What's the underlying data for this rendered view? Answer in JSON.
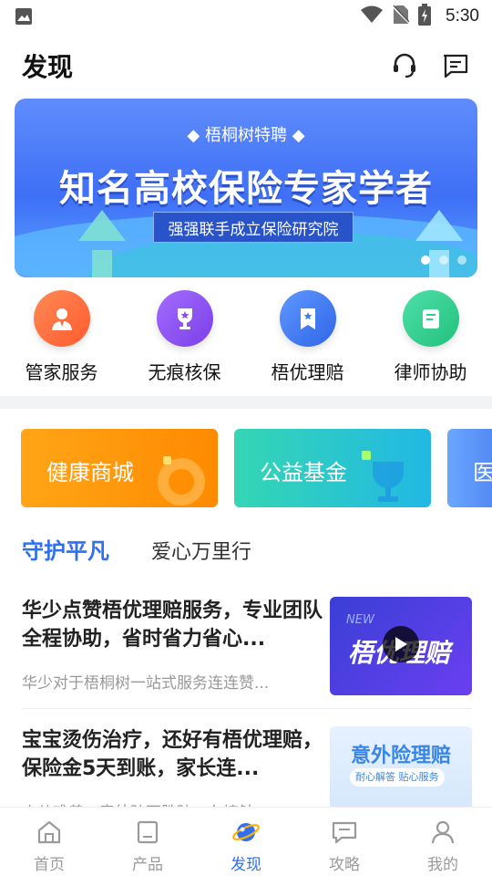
{
  "status_bar": {
    "time": "5:30"
  },
  "header": {
    "title": "发现"
  },
  "banner": {
    "subtitle": "◆ 梧桐树特聘 ◆",
    "title": "知名高校保险专家学者",
    "tag": "强强联手成立保险研究院",
    "slide_count": 3,
    "active_slide": 1
  },
  "quick_actions": [
    {
      "label": "管家服务",
      "icon": "butler-icon",
      "color": "#ff6a3d"
    },
    {
      "label": "无痕核保",
      "icon": "trophy-icon",
      "color": "#8a4cf0"
    },
    {
      "label": "梧优理赔",
      "icon": "claim-icon",
      "color": "#3f7cf2"
    },
    {
      "label": "律师协助",
      "icon": "document-icon",
      "color": "#2fcf8e"
    }
  ],
  "promo_cards": [
    {
      "label": "健康商城"
    },
    {
      "label": "公益基金"
    },
    {
      "label": "医"
    }
  ],
  "tabs": [
    {
      "label": "守护平凡",
      "active": true
    },
    {
      "label": "爱心万里行",
      "active": false
    }
  ],
  "articles": [
    {
      "title": "华少点赞梧优理赔服务，专业团队全程协助，省时省力省心...",
      "desc": "华少对于梧桐树一站式服务连连赞...",
      "thumb_text": "梧优理赔",
      "thumb_badge": "NEW"
    },
    {
      "title": "宝宝烫伤治疗，还好有梧优理赔，保险金5天到账，家长连...",
      "desc": "小儿难养，意外防不胜防，在接触",
      "thumb_text": "意外险理赔",
      "thumb_pill": "耐心解答 贴心服务"
    }
  ],
  "bottom_nav": [
    {
      "label": "首页",
      "active": false
    },
    {
      "label": "产品",
      "active": false
    },
    {
      "label": "发现",
      "active": true
    },
    {
      "label": "攻略",
      "active": false
    },
    {
      "label": "我的",
      "active": false
    }
  ],
  "colors": {
    "accent": "#2f6ff0"
  }
}
